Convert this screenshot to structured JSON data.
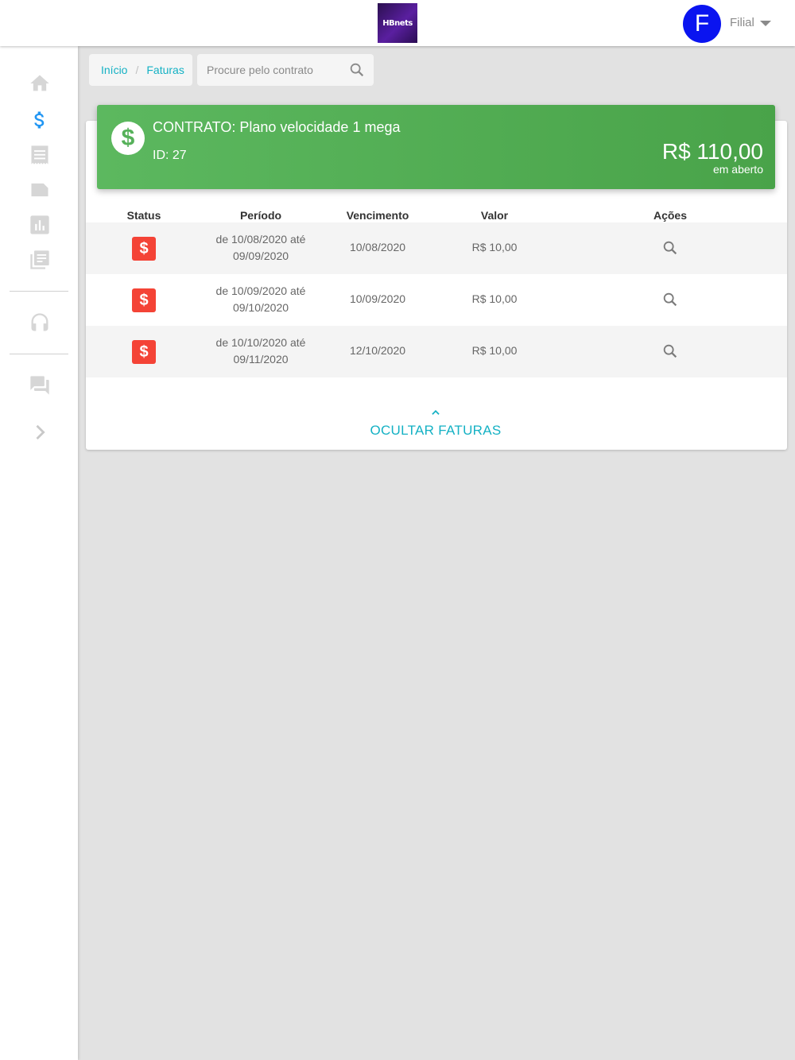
{
  "header": {
    "logo_text": "HBnets",
    "avatar_initial": "F",
    "branch_label": "Filial"
  },
  "breadcrumb": {
    "home": "Início",
    "separator": "/",
    "current": "Faturas"
  },
  "search": {
    "placeholder": "Procure pelo contrato"
  },
  "contract": {
    "title": "CONTRATO: Plano velocidade 1 mega",
    "id_text": "ID: 27",
    "amount": "R$ 110,00",
    "status": "em aberto",
    "banner_color": "#4caf50"
  },
  "table": {
    "headers": {
      "status": "Status",
      "period": "Período",
      "due": "Vencimento",
      "value": "Valor",
      "actions": "Ações"
    },
    "rows": [
      {
        "status_icon": "$",
        "period_start": "de 10/08/2020 até",
        "period_end": "09/09/2020",
        "due": "10/08/2020",
        "value": "R$ 10,00"
      },
      {
        "status_icon": "$",
        "period_start": "de 10/09/2020 até",
        "period_end": "09/10/2020",
        "due": "10/09/2020",
        "value": "R$ 10,00"
      },
      {
        "status_icon": "$",
        "period_start": "de 10/10/2020 até",
        "period_end": "09/11/2020",
        "due": "12/10/2020",
        "value": "R$ 10,00"
      }
    ]
  },
  "hide_invoices_label": "OCULTAR FATURAS",
  "colors": {
    "accent": "#14b1c4",
    "unpaid_badge": "#f44336",
    "avatar": "#0a14f0",
    "sidebar_active": "#2196f3"
  },
  "sidebar": {
    "items": [
      {
        "icon": "home-icon",
        "active": false
      },
      {
        "icon": "dollar-icon",
        "active": true
      },
      {
        "icon": "receipt-icon",
        "active": false
      },
      {
        "icon": "label-icon",
        "active": false
      },
      {
        "icon": "bar-chart-icon",
        "active": false
      },
      {
        "icon": "library-books-icon",
        "active": false
      },
      {
        "icon": "headset-icon",
        "active": false
      },
      {
        "icon": "forum-icon",
        "active": false
      },
      {
        "icon": "chevron-right-icon",
        "active": false
      }
    ]
  }
}
